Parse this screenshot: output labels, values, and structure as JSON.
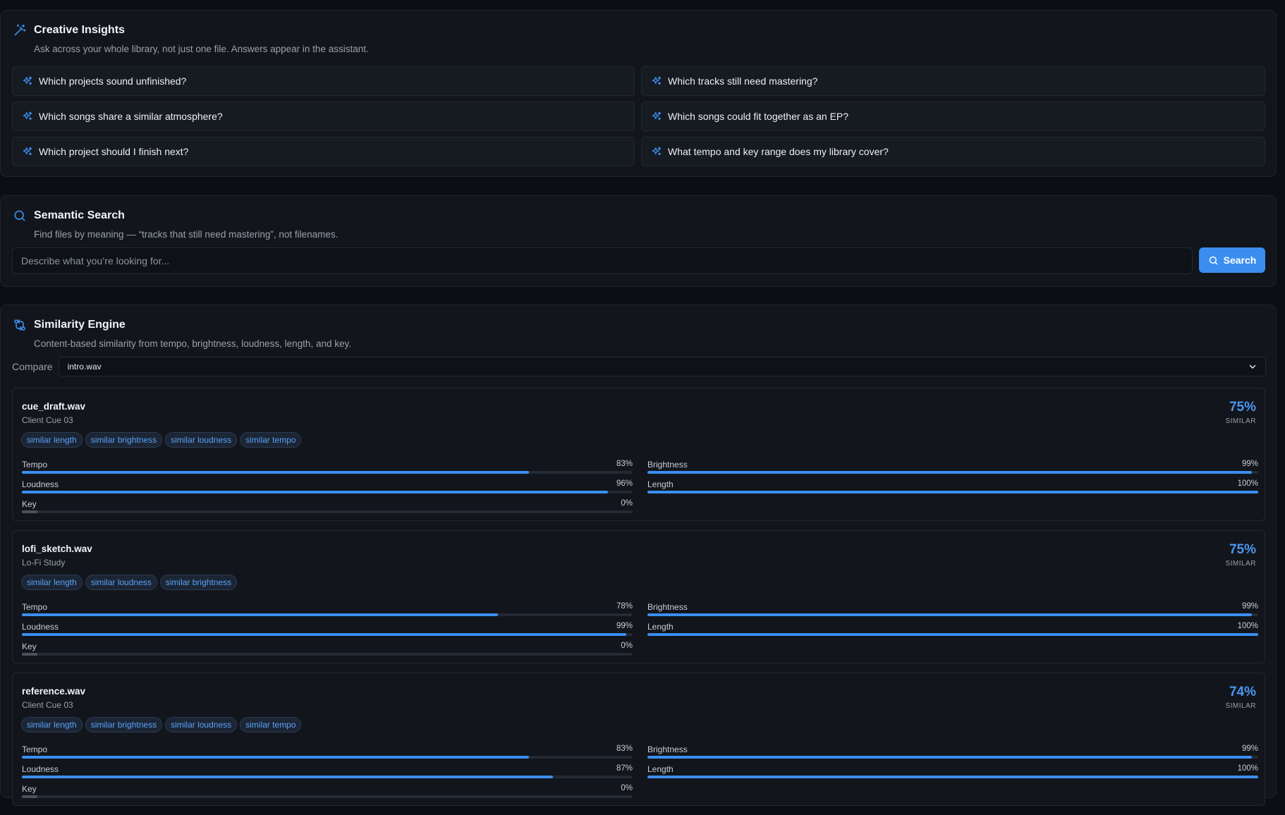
{
  "colors": {
    "accent": "#3b8ef0",
    "background": "#0b0e13",
    "panel": "#12151b"
  },
  "insights": {
    "title": "Creative Insights",
    "subtitle": "Ask across your whole library, not just one file. Answers appear in the assistant.",
    "icon": "magic-wand-icon",
    "prompts": [
      "Which projects sound unfinished?",
      "Which tracks still need mastering?",
      "Which songs share a similar atmosphere?",
      "Which songs could fit together as an EP?",
      "Which project should I finish next?",
      "What tempo and key range does my library cover?"
    ]
  },
  "search": {
    "title": "Semantic Search",
    "subtitle": "Find files by meaning — “tracks that still need mastering”, not filenames.",
    "placeholder": "Describe what you’re looking for...",
    "button_label": "Search",
    "icon": "search-icon"
  },
  "similarity": {
    "title": "Similarity Engine",
    "subtitle": "Content-based similarity from tempo, brightness, loudness, length, and key.",
    "compare_label": "Compare",
    "compare_value": "intro.wav",
    "icon": "compare-arrows-icon",
    "similar_label": "SIMILAR",
    "results": [
      {
        "file": "cue_draft.wav",
        "project": "Client Cue 03",
        "score": "75%",
        "tags": [
          "similar length",
          "similar brightness",
          "similar loudness",
          "similar tempo"
        ],
        "metrics": [
          {
            "label": "Tempo",
            "value": "83%",
            "level": 83
          },
          {
            "label": "Brightness",
            "value": "99%",
            "level": 99
          },
          {
            "label": "Loudness",
            "value": "96%",
            "level": 96
          },
          {
            "label": "Length",
            "value": "100%",
            "level": 100
          },
          {
            "label": "Key",
            "value": "0%",
            "level": 0
          }
        ]
      },
      {
        "file": "lofi_sketch.wav",
        "project": "Lo-Fi Study",
        "score": "75%",
        "tags": [
          "similar length",
          "similar loudness",
          "similar brightness"
        ],
        "metrics": [
          {
            "label": "Tempo",
            "value": "78%",
            "level": 78
          },
          {
            "label": "Brightness",
            "value": "99%",
            "level": 99
          },
          {
            "label": "Loudness",
            "value": "99%",
            "level": 99
          },
          {
            "label": "Length",
            "value": "100%",
            "level": 100
          },
          {
            "label": "Key",
            "value": "0%",
            "level": 0
          }
        ]
      },
      {
        "file": "reference.wav",
        "project": "Client Cue 03",
        "score": "74%",
        "tags": [
          "similar length",
          "similar brightness",
          "similar loudness",
          "similar tempo"
        ],
        "metrics": [
          {
            "label": "Tempo",
            "value": "83%",
            "level": 83
          },
          {
            "label": "Brightness",
            "value": "99%",
            "level": 99
          },
          {
            "label": "Loudness",
            "value": "87%",
            "level": 87
          },
          {
            "label": "Length",
            "value": "100%",
            "level": 100
          },
          {
            "label": "Key",
            "value": "0%",
            "level": 0
          }
        ]
      }
    ]
  }
}
